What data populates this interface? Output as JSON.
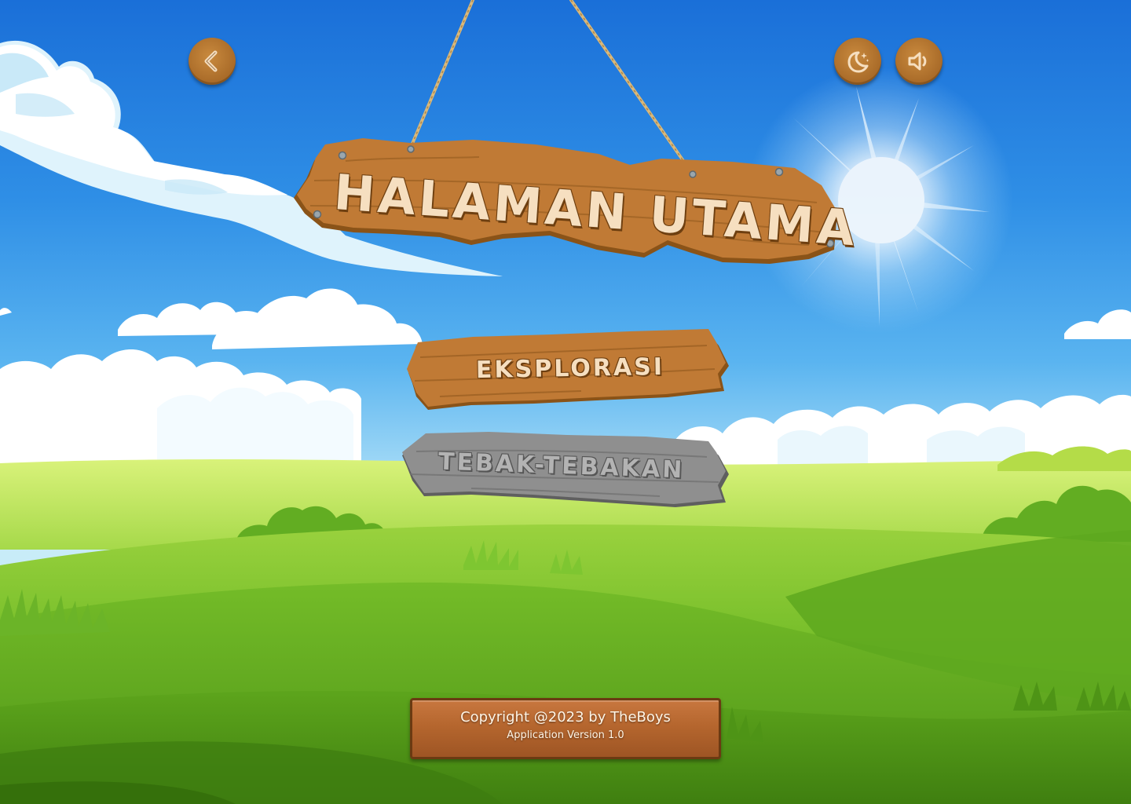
{
  "header": {
    "title": "HALAMAN UTAMA"
  },
  "menu": {
    "explore_label": "EKSPLORASI",
    "guess_label": "TEBAK-TEBAKAN"
  },
  "toolbar": {
    "back_icon": "chevron-left-icon",
    "theme_icon": "moon-stars-icon",
    "sound_icon": "speaker-icon"
  },
  "footer": {
    "copyright": "Copyright @2023 by TheBoys",
    "version": "Application Version 1.0"
  },
  "colors": {
    "wood": "#c07a35",
    "wood_dark": "#8a5318",
    "sign_text": "#f6dfc0",
    "disabled_wood": "#8f8f8f",
    "sky": "#2f8fe6",
    "grass": "#6ab82a"
  }
}
